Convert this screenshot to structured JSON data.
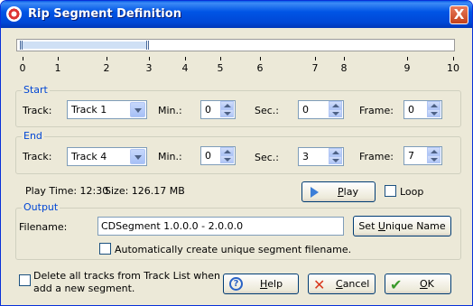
{
  "window": {
    "title": "Rip Segment Definition",
    "close_label": "X"
  },
  "ruler": {
    "ticks": [
      "0",
      "1",
      "2",
      "3",
      "4",
      "5",
      "6",
      "7",
      "8",
      "9",
      "10"
    ],
    "selection_start_fraction": 0.0,
    "selection_end_fraction": 0.3
  },
  "start": {
    "legend": "Start",
    "track_label": "Track:",
    "track_value": "Track 1",
    "min_label": "Min.:",
    "min_value": "0",
    "sec_label": "Sec.:",
    "sec_value": "0",
    "frame_label": "Frame:",
    "frame_value": "0"
  },
  "end": {
    "legend": "End",
    "track_label": "Track:",
    "track_value": "Track 4",
    "min_label": "Min.:",
    "min_value": "0",
    "sec_label": "Sec.:",
    "sec_value": "3",
    "frame_label": "Frame:",
    "frame_value": "7"
  },
  "info": {
    "play_time": "Play Time: 12:30",
    "size": "Size: 126.17  MB"
  },
  "play": {
    "label_pre": "",
    "label_u": "P",
    "label_post": "lay"
  },
  "loop": {
    "label": "Loop",
    "checked": false
  },
  "output": {
    "legend": "Output",
    "filename_label": "Filename:",
    "filename_value": "CDSegment 1.0.0.0 - 2.0.0.0",
    "unique_button_pre": "Set ",
    "unique_button_u": "U",
    "unique_button_post": "nique Name",
    "auto_label": "Automatically create unique segment filename.",
    "auto_checked": false
  },
  "delete_tracks": {
    "line1": "Delete all tracks from Track List when",
    "line2": "add a new segment.",
    "checked": false
  },
  "buttons": {
    "help_pre": "",
    "help_u": "H",
    "help_post": "elp",
    "cancel_pre": "",
    "cancel_u": "C",
    "cancel_post": "ancel",
    "ok_pre": "",
    "ok_u": "O",
    "ok_post": "K"
  },
  "colors": {
    "title_bar": "#0055e5",
    "legend_text": "#0046d5",
    "face": "#ece9d8"
  }
}
